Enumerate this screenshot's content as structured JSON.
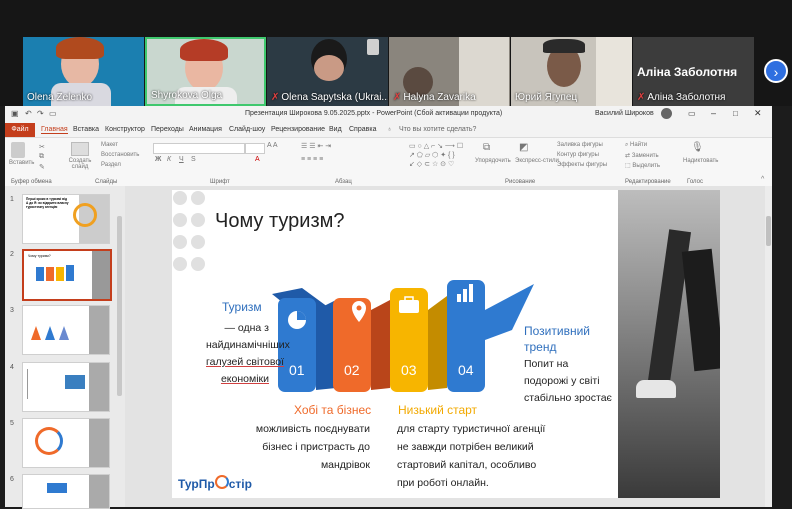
{
  "participants": [
    {
      "name": "Olena Zelenko",
      "muted": false
    },
    {
      "name": "Shyrokova Olga",
      "muted": false
    },
    {
      "name": "Olena Sapytska (Ukrai...",
      "muted": true
    },
    {
      "name": "Halyna Zavarika",
      "muted": true
    },
    {
      "name": "Юрий Ягупец",
      "muted": false
    },
    {
      "name": "Аліна Заболотня",
      "muted": true
    }
  ],
  "featured_name": "Аліна Заболотня",
  "ppt": {
    "window_title": "Презентация Широкова 9.05.2025.pptx  -  PowerPoint (Сбой активации продукта)",
    "user": "Василий Широков",
    "tabs": [
      "Файл",
      "Главная",
      "Вставка",
      "Конструктор",
      "Переходы",
      "Анимация",
      "Слайд-шоу",
      "Рецензирование",
      "Вид",
      "Справка"
    ],
    "search_hint": "Что вы хотите сделать?",
    "ribbon": {
      "paste": "Вставить",
      "create_slide": "Создать слайд",
      "layout": "Макет",
      "reset": "Восстановить",
      "section": "Раздел",
      "arrange": "Упорядочить",
      "quick_styles": "Экспресс-стили",
      "shape_fill": "Заливка фигуры",
      "shape_outline": "Контур фигуры",
      "shape_effects": "Эффекты фигуры",
      "find": "Найти",
      "replace": "Заменить",
      "select": "Выделить",
      "dictate": "Надиктовать",
      "groups": [
        "Буфер обмена",
        "Слайды",
        "Шрифт",
        "Абзац",
        "Рисование",
        "Редактирование",
        "Голос"
      ]
    }
  },
  "thumb_numbers": [
    "1",
    "2",
    "3",
    "4",
    "5",
    "6"
  ],
  "thumb1_title": "Перші кроки в туризмі від А до Я: як відкрити власну туристичну агенцію",
  "thumb2_title": "Чому туризм?",
  "slide": {
    "title": "Чому туризм?",
    "block1_head": "Туризм",
    "block1_lines": [
      "— одна з",
      "найдинамічніших",
      "галузей світової",
      "економіки"
    ],
    "numbers": [
      "01",
      "02",
      "03",
      "04"
    ],
    "block2_head": "Хобі та бізнес",
    "block2_lines": [
      "можливість поєднувати",
      "бізнес і пристрасть до",
      "мандрівок"
    ],
    "block3_head": "Низький старт",
    "block3_lines": [
      "для старту туристичної агенції",
      "не завжди потрібен великий",
      "стартовий капітал, особливо",
      "при роботі онлайн."
    ],
    "block4_head_1": "Позитивний",
    "block4_head_2": "тренд",
    "block4_lines": [
      "Попит на",
      "подорожі у світі",
      "стабільно зростає"
    ],
    "logo_a": "ТурПр",
    "logo_b": "стір"
  },
  "colors": {
    "blue": "#2f7ad0",
    "orange": "#ef6a2a",
    "yellow": "#f7b500",
    "accent": "#c43e1c"
  }
}
